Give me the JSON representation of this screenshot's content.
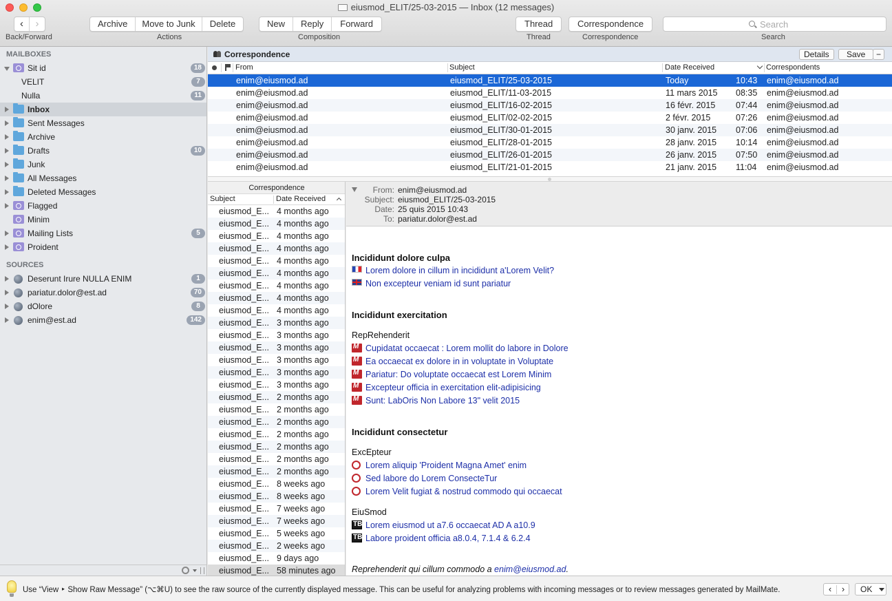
{
  "window": {
    "title": "eiusmod_ELIT/25-03-2015 — Inbox (12 messages)"
  },
  "toolbar": {
    "back_forward": {
      "back_glyph": "‹",
      "forward_glyph": "›",
      "label": "Back/Forward"
    },
    "actions": {
      "archive": "Archive",
      "move_to_junk": "Move to Junk",
      "delete": "Delete",
      "label": "Actions"
    },
    "composition": {
      "new": "New",
      "reply": "Reply",
      "forward": "Forward",
      "label": "Composition"
    },
    "thread": {
      "button": "Thread",
      "label": "Thread"
    },
    "correspondence": {
      "button": "Correspondence",
      "label": "Correspondence"
    },
    "search": {
      "placeholder": "Search",
      "label": "Search"
    }
  },
  "sidebar": {
    "mailboxes_header": "MAILBOXES",
    "mailboxes": [
      {
        "label": "Sit id",
        "badge": "18",
        "icon": "smart-mailbox-icon"
      },
      {
        "label": "VELIT",
        "badge": "7"
      },
      {
        "label": "Nulla",
        "badge": "11"
      },
      {
        "label": "Inbox",
        "badge": "",
        "icon": "folder-icon"
      },
      {
        "label": "Sent Messages",
        "badge": "",
        "icon": "folder-icon"
      },
      {
        "label": "Archive",
        "badge": "",
        "icon": "folder-icon"
      },
      {
        "label": "Drafts",
        "badge": "10",
        "icon": "folder-icon"
      },
      {
        "label": "Junk",
        "badge": "",
        "icon": "folder-icon"
      },
      {
        "label": "All Messages",
        "badge": "",
        "icon": "folder-icon"
      },
      {
        "label": "Deleted Messages",
        "badge": "",
        "icon": "folder-icon"
      },
      {
        "label": "Flagged",
        "badge": "",
        "icon": "smart-mailbox-icon"
      },
      {
        "label": "Minim",
        "badge": "",
        "icon": "smart-mailbox-icon"
      },
      {
        "label": "Mailing Lists",
        "badge": "5",
        "icon": "smart-mailbox-icon"
      },
      {
        "label": "Proident",
        "badge": "",
        "icon": "smart-mailbox-icon"
      }
    ],
    "sources_header": "SOURCES",
    "sources": [
      {
        "label": "Deserunt Irure NULLA ENIM",
        "badge": "1",
        "icon": "globe-icon"
      },
      {
        "label": "pariatur.dolor@est.ad",
        "badge": "70",
        "icon": "globe-icon"
      },
      {
        "label": "dOlore",
        "badge": "8",
        "icon": "globe-icon"
      },
      {
        "label": "enim@est.ad",
        "badge": "142",
        "icon": "globe-icon"
      }
    ]
  },
  "message_list": {
    "title": "Correspondence",
    "details_button": "Details",
    "save_button": "Save",
    "collapse_button": "−",
    "columns": {
      "from": "From",
      "subject": "Subject",
      "date": "Date Received",
      "correspondents": "Correspondents"
    },
    "rows": [
      {
        "from": "enim@eiusmod.ad",
        "subject": "eiusmod_ELIT/25-03-2015",
        "date": "Today",
        "time": "10:43",
        "correspondents": "enim@eiusmod.ad"
      },
      {
        "from": "enim@eiusmod.ad",
        "subject": "eiusmod_ELIT/11-03-2015",
        "date": "11 mars 2015",
        "time": "08:35",
        "correspondents": "enim@eiusmod.ad"
      },
      {
        "from": "enim@eiusmod.ad",
        "subject": "eiusmod_ELIT/16-02-2015",
        "date": "16 févr. 2015",
        "time": "07:44",
        "correspondents": "enim@eiusmod.ad"
      },
      {
        "from": "enim@eiusmod.ad",
        "subject": "eiusmod_ELIT/02-02-2015",
        "date": "2 févr. 2015",
        "time": "07:26",
        "correspondents": "enim@eiusmod.ad"
      },
      {
        "from": "enim@eiusmod.ad",
        "subject": "eiusmod_ELIT/30-01-2015",
        "date": "30 janv. 2015",
        "time": "07:06",
        "correspondents": "enim@eiusmod.ad"
      },
      {
        "from": "enim@eiusmod.ad",
        "subject": "eiusmod_ELIT/28-01-2015",
        "date": "28 janv. 2015",
        "time": "10:14",
        "correspondents": "enim@eiusmod.ad"
      },
      {
        "from": "enim@eiusmod.ad",
        "subject": "eiusmod_ELIT/26-01-2015",
        "date": "26 janv. 2015",
        "time": "07:50",
        "correspondents": "enim@eiusmod.ad"
      },
      {
        "from": "enim@eiusmod.ad",
        "subject": "eiusmod_ELIT/21-01-2015",
        "date": "21 janv. 2015",
        "time": "11:04",
        "correspondents": "enim@eiusmod.ad"
      }
    ]
  },
  "thread_pane": {
    "title": "Correspondence",
    "col_subject": "Subject",
    "col_date": "Date Received",
    "rows": [
      {
        "subject": "eiusmod_E...",
        "date": "4 months ago"
      },
      {
        "subject": "eiusmod_E...",
        "date": "4 months ago"
      },
      {
        "subject": "eiusmod_E...",
        "date": "4 months ago"
      },
      {
        "subject": "eiusmod_E...",
        "date": "4 months ago"
      },
      {
        "subject": "eiusmod_E...",
        "date": "4 months ago"
      },
      {
        "subject": "eiusmod_E...",
        "date": "4 months ago"
      },
      {
        "subject": "eiusmod_E...",
        "date": "4 months ago"
      },
      {
        "subject": "eiusmod_E...",
        "date": "4 months ago"
      },
      {
        "subject": "eiusmod_E...",
        "date": "4 months ago"
      },
      {
        "subject": "eiusmod_E...",
        "date": "3 months ago"
      },
      {
        "subject": "eiusmod_E...",
        "date": "3 months ago"
      },
      {
        "subject": "eiusmod_E...",
        "date": "3 months ago"
      },
      {
        "subject": "eiusmod_E...",
        "date": "3 months ago"
      },
      {
        "subject": "eiusmod_E...",
        "date": "3 months ago"
      },
      {
        "subject": "eiusmod_E...",
        "date": "3 months ago"
      },
      {
        "subject": "eiusmod_E...",
        "date": "2 months ago"
      },
      {
        "subject": "eiusmod_E...",
        "date": "2 months ago"
      },
      {
        "subject": "eiusmod_E...",
        "date": "2 months ago"
      },
      {
        "subject": "eiusmod_E...",
        "date": "2 months ago"
      },
      {
        "subject": "eiusmod_E...",
        "date": "2 months ago"
      },
      {
        "subject": "eiusmod_E...",
        "date": "2 months ago"
      },
      {
        "subject": "eiusmod_E...",
        "date": "2 months ago"
      },
      {
        "subject": "eiusmod_E...",
        "date": "8 weeks ago"
      },
      {
        "subject": "eiusmod_E...",
        "date": "8 weeks ago"
      },
      {
        "subject": "eiusmod_E...",
        "date": "7 weeks ago"
      },
      {
        "subject": "eiusmod_E...",
        "date": "7 weeks ago"
      },
      {
        "subject": "eiusmod_E...",
        "date": "5 weeks ago"
      },
      {
        "subject": "eiusmod_E...",
        "date": "2 weeks ago"
      },
      {
        "subject": "eiusmod_E...",
        "date": "9 days ago"
      },
      {
        "subject": "eiusmod_E...",
        "date": "58 minutes ago"
      }
    ]
  },
  "message_view": {
    "header": {
      "from_label": "From:",
      "from": "enim@eiusmod.ad",
      "subject_label": "Subject:",
      "subject": "eiusmod_ELIT/25-03-2015",
      "date_label": "Date:",
      "date": "25 quis 2015 10:43",
      "to_label": "To:",
      "to": "pariatur.dolor@est.ad"
    },
    "sections": {
      "s1_title": "Incididunt dolore culpa",
      "s1_links": [
        "Lorem dolore in cillum in incididunt a'Lorem Velit?",
        "Non excepteur veniam id sunt pariatur"
      ],
      "s2_title": "Incididunt exercitation",
      "s2_sub": "RepRehenderit",
      "s2_links": [
        "Cupidatat occaecat : Lorem mollit do labore in Dolore",
        "Ea occaecat ex dolore in in voluptate in Voluptate",
        "Pariatur: Do voluptate occaecat est Lorem Minim",
        "Excepteur officia in exercitation elit-adipisicing",
        "Sunt: LabOris Non Labore 13\" velit 2015"
      ],
      "s3_title": "Incididunt consectetur",
      "s3_sub1": "ExcEpteur",
      "s3_links1": [
        "Lorem aliquip 'Proident Magna Amet' enim",
        "Sed labore do Lorem ConsecteTur",
        "Lorem Velit fugiat & nostrud commodo qui occaecat"
      ],
      "s3_sub2": "EiuSmod",
      "s3_links2": [
        "Lorem eiusmod ut a7.6 occaecat AD A a10.9",
        "Labore proident officia a8.0.4, 7.1.4 & 6.2.4"
      ],
      "footer_text": "Reprehenderit qui cillum commodo a ",
      "footer_link": "enim@eiusmod.ad",
      "footer_end": "."
    }
  },
  "tip_bar": {
    "text": "Use “View ‣ Show Raw Message” (⌥⌘U) to see the raw source of the currently displayed message. This can be useful for analyzing problems with incoming messages or to review messages generated by MailMate.",
    "prev": "‹",
    "next": "›",
    "ok": "OK"
  },
  "colors": {
    "selection": "#1b67d6",
    "badge": "#9ba4b2",
    "link": "#1d2fa8",
    "sidebar_bg": "#e7e9ec"
  }
}
